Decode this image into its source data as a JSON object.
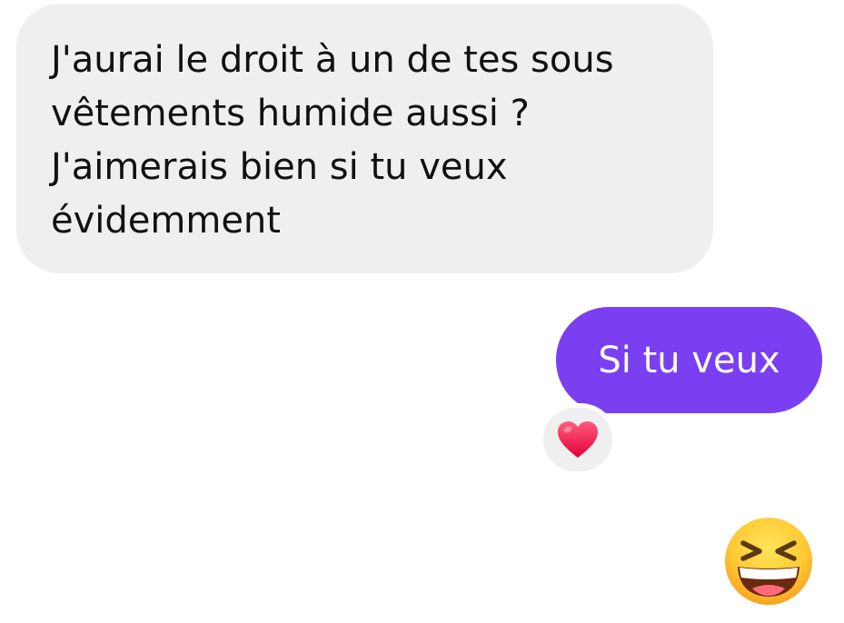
{
  "conversation": {
    "received_message": {
      "lines": [
        "J'aurai le droit à un de tes sous",
        "vêtements humide aussi ?",
        "J'aimerais bien si tu veux",
        "évidemment"
      ]
    },
    "sent_message": {
      "text": "Si tu veux"
    },
    "reaction": {
      "icon": "red-heart-icon",
      "color": "#ff2d55"
    },
    "emoji_message": {
      "icon": "grinning-squinting-face-icon"
    }
  },
  "colors": {
    "received_bubble": "#efeff0",
    "sent_bubble": "#7b3ff2",
    "sent_text": "#ffffff",
    "received_text": "#111111"
  }
}
